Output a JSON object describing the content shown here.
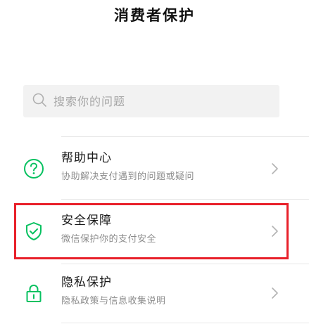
{
  "header": {
    "title": "消费者保护"
  },
  "search": {
    "placeholder": "搜索你的问题",
    "value": ""
  },
  "menu": {
    "items": [
      {
        "title": "帮助中心",
        "subtitle": "协助解决支付遇到的问题或疑问",
        "icon": "help-circle-icon"
      },
      {
        "title": "安全保障",
        "subtitle": "微信保护你的支付安全",
        "icon": "shield-check-icon",
        "highlighted": true
      },
      {
        "title": "隐私保护",
        "subtitle": "隐私政策与信息收集说明",
        "icon": "lock-icon"
      }
    ]
  },
  "colors": {
    "accent": "#07c160",
    "highlight_border": "#e8202a",
    "subtitle_text": "#8c8c8c",
    "search_background": "#f2f2f2"
  }
}
